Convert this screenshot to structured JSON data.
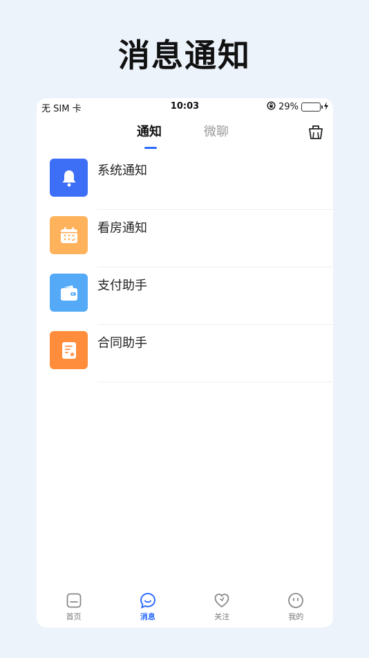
{
  "headline": "消息通知",
  "status_bar": {
    "carrier": "无 SIM 卡",
    "time": "10:03",
    "battery_percent": "29%"
  },
  "tabs": [
    {
      "label": "通知",
      "active": true
    },
    {
      "label": "微聊",
      "active": false
    }
  ],
  "actions": {
    "clean_icon": "broom-icon"
  },
  "notifications": [
    {
      "label": "系统通知",
      "icon": "bell-icon",
      "color": "#3d6ef6"
    },
    {
      "label": "看房通知",
      "icon": "calendar-icon",
      "color": "#ffb25c"
    },
    {
      "label": "支付助手",
      "icon": "wallet-icon",
      "color": "#55aaf7"
    },
    {
      "label": "合同助手",
      "icon": "contract-icon",
      "color": "#ff8d3c"
    }
  ],
  "tabbar": [
    {
      "label": "首页",
      "icon": "home-icon",
      "active": false
    },
    {
      "label": "消息",
      "icon": "message-icon",
      "active": true
    },
    {
      "label": "关注",
      "icon": "heart-icon",
      "active": false
    },
    {
      "label": "我的",
      "icon": "profile-icon",
      "active": false
    }
  ],
  "colors": {
    "accent": "#2c6bff",
    "background": "#edf3fb"
  }
}
